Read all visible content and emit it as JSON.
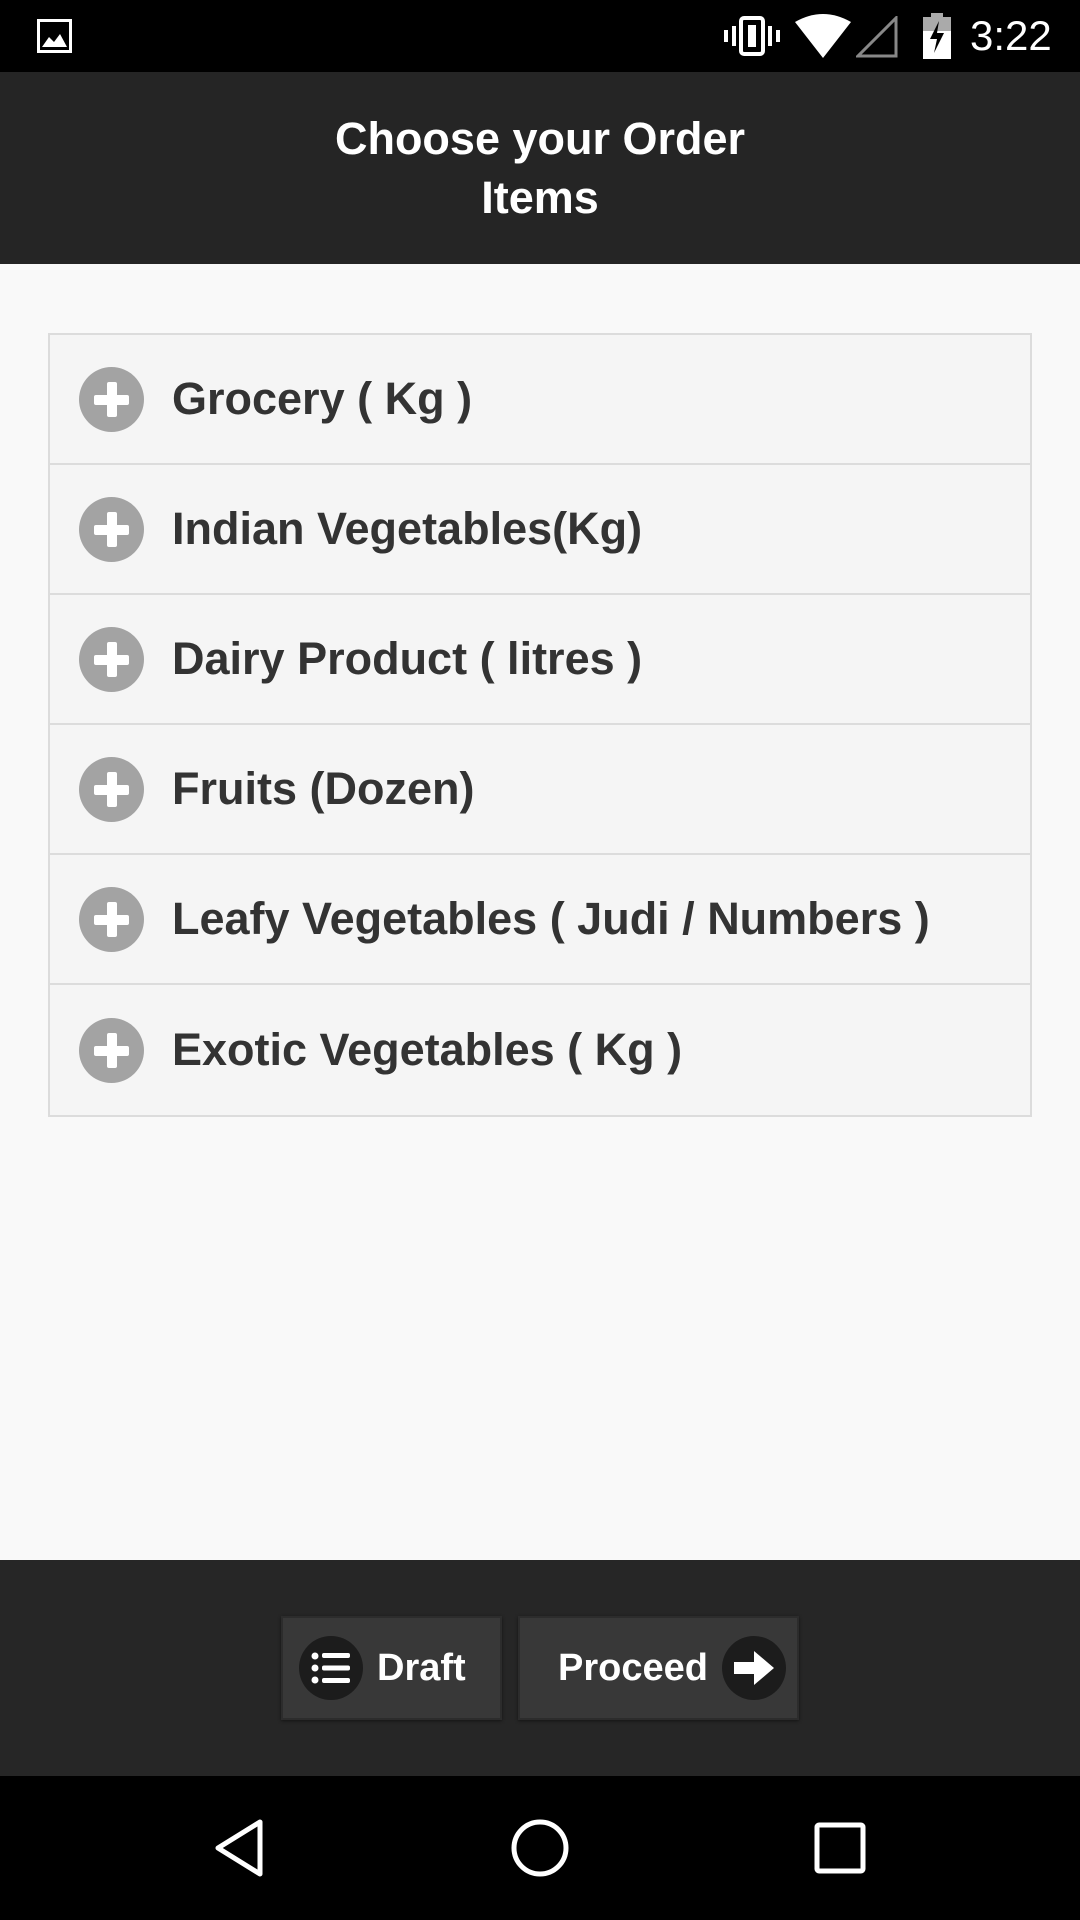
{
  "status_bar": {
    "time": "3:22",
    "icons": [
      "gallery-icon",
      "vibrate-icon",
      "wifi-icon",
      "signal-icon",
      "battery-charging-icon"
    ]
  },
  "header": {
    "title": "Choose your Order Items"
  },
  "categories": [
    {
      "label": "Grocery ( Kg )",
      "icon": "plus-circle-icon"
    },
    {
      "label": "Indian Vegetables(Kg)",
      "icon": "plus-circle-icon"
    },
    {
      "label": "Dairy Product ( litres )",
      "icon": "plus-circle-icon"
    },
    {
      "label": "Fruits (Dozen)",
      "icon": "plus-circle-icon"
    },
    {
      "label": "Leafy Vegetables ( Judi / Numbers )",
      "icon": "plus-circle-icon"
    },
    {
      "label": "Exotic Vegetables ( Kg )",
      "icon": "plus-circle-icon"
    }
  ],
  "footer": {
    "draft_label": "Draft",
    "draft_icon": "list-icon",
    "proceed_label": "Proceed",
    "proceed_icon": "arrow-right-icon"
  },
  "navigation": {
    "icons": [
      "back-icon",
      "home-icon",
      "recents-icon"
    ]
  },
  "colors": {
    "header_bg": "#252525",
    "footer_bg": "#262626",
    "button_bg": "#383838",
    "plus_icon": "#a3a3a3",
    "list_bg": "#f5f5f5",
    "text_dark": "#333333"
  }
}
